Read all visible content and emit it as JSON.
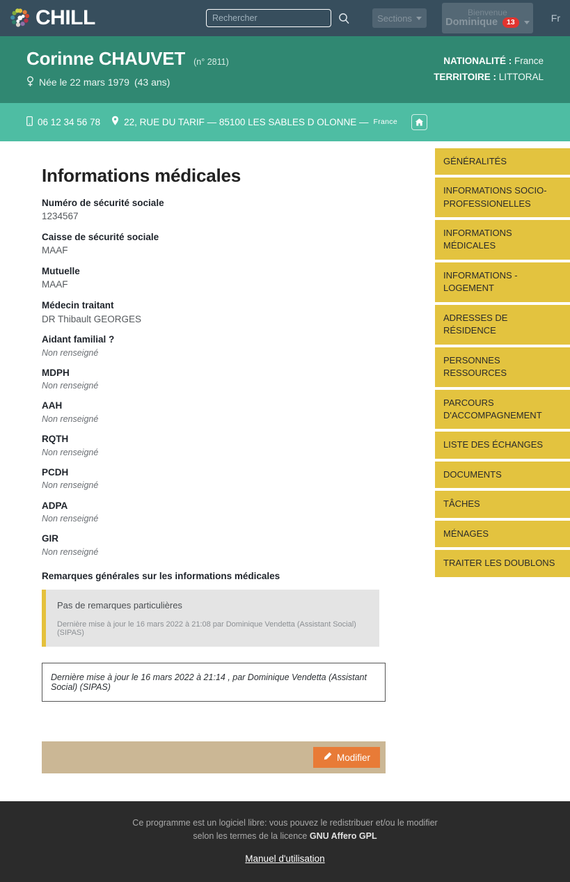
{
  "navbar": {
    "brand": "CHILL",
    "brand_icon": "chill-dots-logo",
    "search": {
      "placeholder": "Rechercher",
      "value": "",
      "icon": "search-icon"
    },
    "sections_label": "Sections",
    "user": {
      "greeting": "Bienvenue",
      "name": "Dominique",
      "badge": "13"
    },
    "language": "Fr"
  },
  "person": {
    "name": "Corinne CHAUVET",
    "number": "(n° 2811)",
    "gender_icon": "female-icon",
    "birth": "Née le 22 mars 1979",
    "age": "(43 ans)",
    "nationality_label": "NATIONALITÉ :",
    "nationality_value": "France",
    "territory_label": "TERRITOIRE :",
    "territory_value": "LITTORAL",
    "phone_icon": "mobile-phone-icon",
    "phone": "06 12 34 56 78",
    "address_icon": "map-pin-icon",
    "address": "22, RUE DU TARIF — 85100 LES SABLES D OLONNE —",
    "address_country": "France",
    "home_icon": "home-icon"
  },
  "main": {
    "title": "Informations médicales",
    "fields": [
      {
        "label": "Numéro de sécurité sociale",
        "value": "1234567",
        "empty": false
      },
      {
        "label": "Caisse de sécurité sociale",
        "value": "MAAF",
        "empty": false
      },
      {
        "label": "Mutuelle",
        "value": "MAAF",
        "empty": false
      },
      {
        "label": "Médecin traitant",
        "value": "DR Thibault GEORGES",
        "empty": false
      },
      {
        "label": "Aidant familial ?",
        "value": "Non renseigné",
        "empty": true
      },
      {
        "label": "MDPH",
        "value": "Non renseigné",
        "empty": true
      },
      {
        "label": "AAH",
        "value": "Non renseigné",
        "empty": true
      },
      {
        "label": "RQTH",
        "value": "Non renseigné",
        "empty": true
      },
      {
        "label": "PCDH",
        "value": "Non renseigné",
        "empty": true
      },
      {
        "label": "ADPA",
        "value": "Non renseigné",
        "empty": true
      },
      {
        "label": "GIR",
        "value": "Non renseigné",
        "empty": true
      }
    ],
    "remarks_title": "Remarques générales sur les informations médicales",
    "remark_text": "Pas de remarques particulières",
    "remark_meta": "Dernière mise à jour le 16 mars 2022 à 21:08 par Dominique Vendetta (Assistant Social) (SIPAS)",
    "update_note": "Dernière mise à jour le 16 mars 2022 à 21:14 , par Dominique Vendetta (Assistant Social) (SIPAS)",
    "edit_button": "Modifier",
    "edit_icon": "pencil-icon"
  },
  "sidebar": {
    "items": [
      {
        "label": "GÉNÉRALITÉS"
      },
      {
        "label": "INFORMATIONS SOCIO-PROFESSIONELLES"
      },
      {
        "label": "INFORMATIONS MÉDICALES"
      },
      {
        "label": "INFORMATIONS - LOGEMENT"
      },
      {
        "label": "ADRESSES DE RÉSIDENCE"
      },
      {
        "label": "PERSONNES RESSOURCES"
      },
      {
        "label": "PARCOURS D'ACCOMPAGNEMENT"
      },
      {
        "label": "LISTE DES ÉCHANGES"
      },
      {
        "label": "DOCUMENTS"
      },
      {
        "label": "TÂCHES"
      },
      {
        "label": "MÉNAGES"
      },
      {
        "label": "TRAITER LES DOUBLONS"
      }
    ]
  },
  "footer": {
    "line1": "Ce programme est un logiciel libre: vous pouvez le redistribuer et/ou le modifier",
    "line2_prefix": "selon les termes de la licence ",
    "line2_strong": "GNU Affero GPL",
    "link": "Manuel d'utilisation"
  },
  "colors": {
    "navbar_bg": "#374E5D",
    "banner_green": "#308872",
    "address_green": "#4EBDA3",
    "sidebar_yellow": "#E3C33F",
    "remark_accent": "#E5C13C",
    "action_bar": "#CBB795",
    "edit_orange": "#E87B37",
    "badge_red": "#E2342F",
    "footer_bg": "#2B2B2B"
  }
}
